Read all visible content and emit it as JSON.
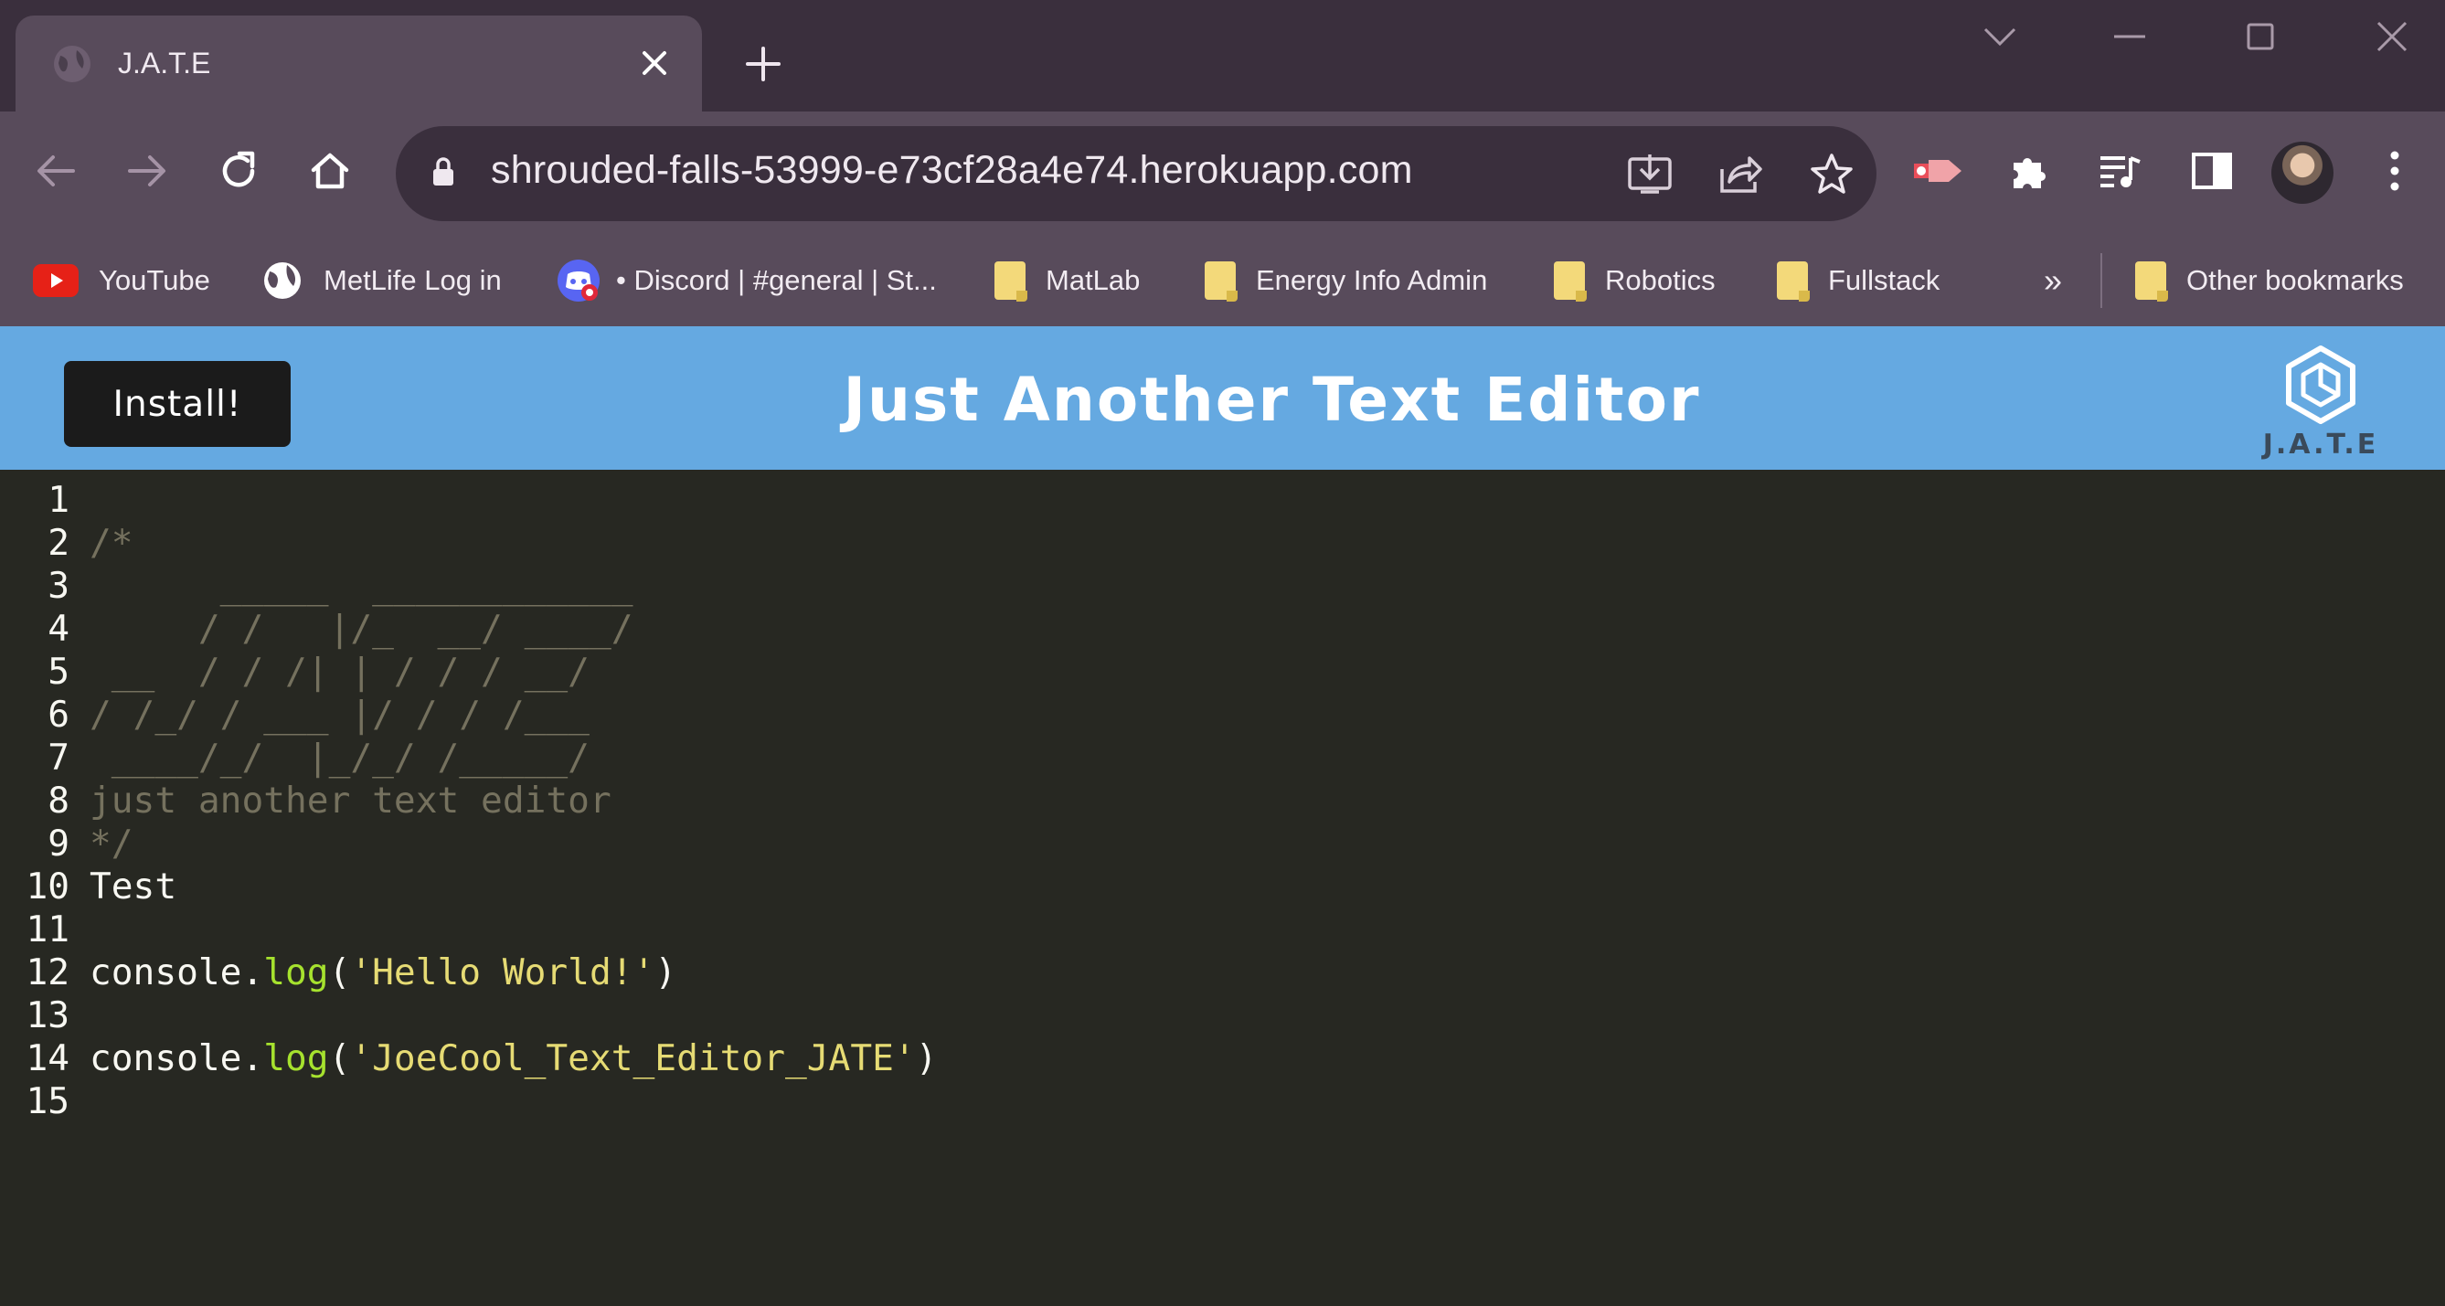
{
  "browser": {
    "tab_title": "J.A.T.E",
    "url": "shrouded-falls-53999-e73cf28a4e74.herokuapp.com",
    "bookmarks": [
      {
        "label": "YouTube",
        "icon": "youtube-icon"
      },
      {
        "label": "MetLife Log in",
        "icon": "globe-icon"
      },
      {
        "label": "• Discord | #general | St...",
        "icon": "discord-icon"
      },
      {
        "label": "MatLab",
        "icon": "folder-icon"
      },
      {
        "label": "Energy Info Admin",
        "icon": "folder-icon"
      },
      {
        "label": "Robotics",
        "icon": "folder-icon"
      },
      {
        "label": "Fullstack",
        "icon": "folder-icon"
      }
    ],
    "more_bookmarks": "»",
    "other_bookmarks": "Other bookmarks"
  },
  "app": {
    "install_label": "Install!",
    "title": "Just Another Text Editor",
    "logo_text": "J.A.T.E"
  },
  "editor": {
    "lines": [
      {
        "n": "1",
        "segments": []
      },
      {
        "n": "2",
        "segments": [
          {
            "t": "/*",
            "c": "cm"
          }
        ]
      },
      {
        "n": "3",
        "segments": [
          {
            "t": "      _____  ____________",
            "c": "cm"
          }
        ]
      },
      {
        "n": "4",
        "segments": [
          {
            "t": "     / /   |/_  __/ ____/",
            "c": "cm"
          }
        ]
      },
      {
        "n": "5",
        "segments": [
          {
            "t": " __  / / /| | / / / __/",
            "c": "cm"
          }
        ]
      },
      {
        "n": "6",
        "segments": [
          {
            "t": "/ /_/ / ___ |/ / / /___",
            "c": "cm"
          }
        ]
      },
      {
        "n": "7",
        "segments": [
          {
            "t": " ____/_/  |_/_/ /_____/",
            "c": "cm"
          }
        ]
      },
      {
        "n": "8",
        "segments": [
          {
            "t": "just another text editor",
            "c": "cm"
          }
        ]
      },
      {
        "n": "9",
        "segments": [
          {
            "t": "*/",
            "c": "cm"
          }
        ]
      },
      {
        "n": "10",
        "segments": [
          {
            "t": "Test",
            "c": "code"
          }
        ]
      },
      {
        "n": "11",
        "segments": []
      },
      {
        "n": "12",
        "segments": [
          {
            "t": "console.",
            "c": "code"
          },
          {
            "t": "log",
            "c": "fn"
          },
          {
            "t": "(",
            "c": "code"
          },
          {
            "t": "'Hello World!'",
            "c": "str"
          },
          {
            "t": ")",
            "c": "code"
          }
        ]
      },
      {
        "n": "13",
        "segments": []
      },
      {
        "n": "14",
        "segments": [
          {
            "t": "console.",
            "c": "code"
          },
          {
            "t": "log",
            "c": "fn"
          },
          {
            "t": "(",
            "c": "code"
          },
          {
            "t": "'JoeCool_Text_Editor_JATE'",
            "c": "str"
          },
          {
            "t": ")",
            "c": "code"
          }
        ]
      },
      {
        "n": "15",
        "segments": []
      }
    ]
  }
}
